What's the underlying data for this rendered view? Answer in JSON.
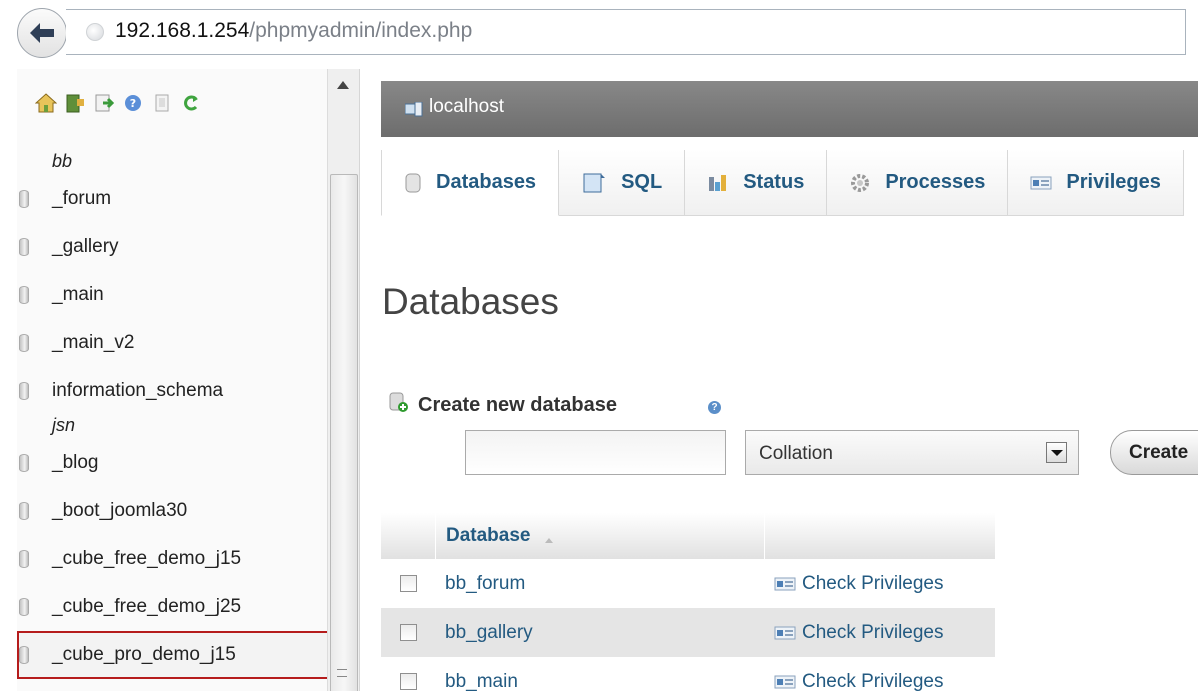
{
  "browser": {
    "url_host": "192.168.1.254",
    "url_path": "/phpmyadmin/index.php"
  },
  "navigation": {
    "toolbar_icons": [
      "home-icon",
      "logout-icon",
      "query-window-icon",
      "docs-icon",
      "sql-docs-icon",
      "reload-icon"
    ],
    "tree": [
      {
        "type": "group",
        "label": "bb"
      },
      {
        "type": "db",
        "label": "_forum"
      },
      {
        "type": "db",
        "label": "_gallery"
      },
      {
        "type": "db",
        "label": "_main"
      },
      {
        "type": "db",
        "label": "_main_v2"
      },
      {
        "type": "db",
        "label": "information_schema"
      },
      {
        "type": "group",
        "label": "jsn"
      },
      {
        "type": "db",
        "label": "_blog"
      },
      {
        "type": "db",
        "label": "_boot_joomla30"
      },
      {
        "type": "db",
        "label": "_cube_free_demo_j15"
      },
      {
        "type": "db",
        "label": "_cube_free_demo_j25"
      },
      {
        "type": "db",
        "label": "_cube_pro_demo_j15",
        "selected": true
      }
    ]
  },
  "main": {
    "server_label": "localhost",
    "tabs": [
      {
        "label": "Databases",
        "icon": "database-icon",
        "active": true
      },
      {
        "label": "SQL",
        "icon": "sql-icon"
      },
      {
        "label": "Status",
        "icon": "status-chart-icon"
      },
      {
        "label": "Processes",
        "icon": "processes-gear-icon"
      },
      {
        "label": "Privileges",
        "icon": "privileges-icon"
      }
    ],
    "heading": "Databases",
    "create": {
      "label": "Create new database",
      "help": "?",
      "name_value": "",
      "collation_value": "Collation",
      "button_label": "Create"
    },
    "table": {
      "column_header": "Database",
      "rows": [
        {
          "name": "bb_forum",
          "action": "Check Privileges"
        },
        {
          "name": "bb_gallery",
          "action": "Check Privileges"
        },
        {
          "name": "bb_main",
          "action": "Check Privileges"
        }
      ]
    }
  },
  "colors": {
    "link": "#235a81",
    "server_bar": "#777777",
    "selection_outline": "#b51c1c"
  }
}
